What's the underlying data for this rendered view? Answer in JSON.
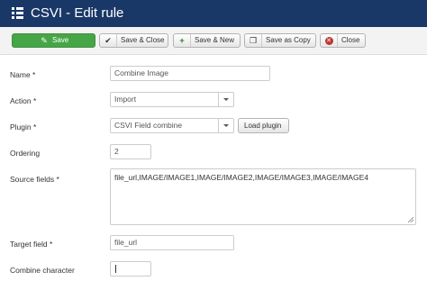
{
  "header": {
    "title": "CSVI - Edit rule",
    "icon": "list-icon"
  },
  "toolbar": {
    "save": {
      "label": "Save",
      "icon": "pencil-check-icon",
      "color": "#46a546"
    },
    "save_close": {
      "label": "Save & Close",
      "icon": "check-icon"
    },
    "save_new": {
      "label": "Save & New",
      "icon": "plus-icon"
    },
    "save_copy": {
      "label": "Save as Copy",
      "icon": "copy-icon"
    },
    "close": {
      "label": "Close",
      "icon": "close-circle-icon"
    }
  },
  "form": {
    "name": {
      "label": "Name *",
      "value": "Combine Image"
    },
    "action": {
      "label": "Action *",
      "value": "Import"
    },
    "plugin": {
      "label": "Plugin *",
      "value": "CSVI Field combine",
      "button": "Load plugin"
    },
    "ordering": {
      "label": "Ordering",
      "value": "2"
    },
    "source_fields": {
      "label": "Source fields *",
      "value": "file_url,IMAGE/IMAGE1,IMAGE/IMAGE2,IMAGE/IMAGE3,IMAGE/IMAGE4"
    },
    "target_field": {
      "label": "Target field *",
      "value": "file_url"
    },
    "combine_character": {
      "label": "Combine character",
      "value": ""
    }
  },
  "colors": {
    "header": "#1a3867",
    "save_button": "#46a546",
    "toolbar_bg": "#f3f3f3"
  }
}
